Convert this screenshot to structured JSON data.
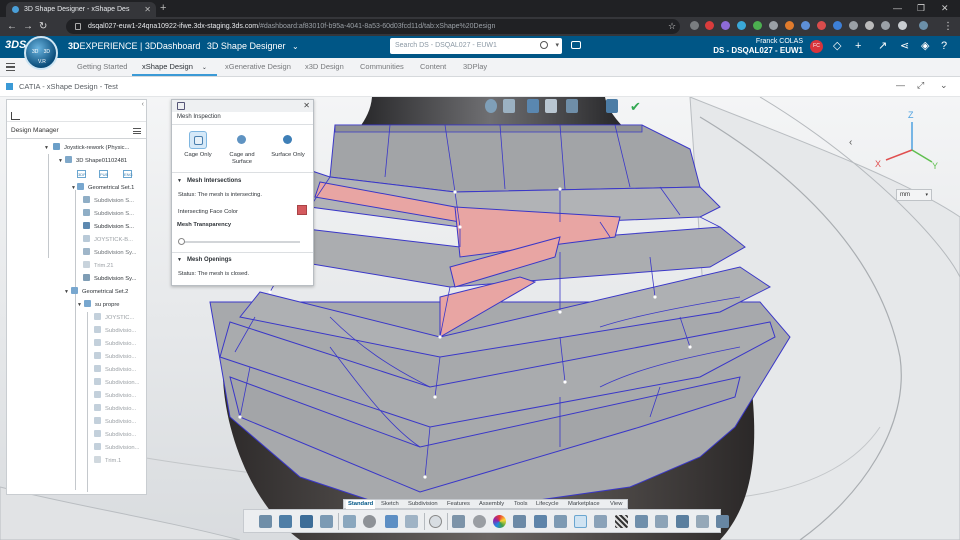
{
  "browser": {
    "tab_title": "3D Shape Designer - xShape Des",
    "url_host": "dsqal027-euw1-24qna10922-ifwe.3dx-staging.3ds.com",
    "url_path": "/#dashboard:af83010f-b95a-4041-8a53-60d03fcd11d/tab:xShape%20Design"
  },
  "header": {
    "brand_bold": "3D",
    "brand_rest": "EXPERIENCE | 3DDashboard",
    "app": "3D Shape Designer",
    "search_placeholder": "Search DS - DSQAL027 - EUW1",
    "user_name": "Franck COLAS",
    "tenant": "DS - DSQAL027 - EUW1",
    "avatar_initials": "FC",
    "compass_labels": [
      "3D",
      "V.R",
      "3D"
    ]
  },
  "dashboard_tabs": [
    {
      "label": "Getting Started"
    },
    {
      "label": "xShape Design"
    },
    {
      "label": "xGenerative Design"
    },
    {
      "label": "x3D Design"
    },
    {
      "label": "Communities"
    },
    {
      "label": "Content"
    },
    {
      "label": "3DPlay"
    }
  ],
  "widget": {
    "title": "CATIA - xShape Design - Test"
  },
  "tree": {
    "title": "Design Manager",
    "icon_labels": [
      "3DP",
      "PUB",
      "ENG"
    ],
    "items": [
      {
        "label": "Joystick-rework (Physic..."
      },
      {
        "label": "3D Shape01102481"
      },
      {
        "label": "Geometrical Set.1"
      },
      {
        "label": "Subdivision S..."
      },
      {
        "label": "Subdivision S..."
      },
      {
        "label": "Subdivision S..."
      },
      {
        "label": "JOYSTICK-B..."
      },
      {
        "label": "Subdivision Sy..."
      },
      {
        "label": "Trim.21"
      },
      {
        "label": "Subdivision Sy..."
      },
      {
        "label": "Geometrical Set.2"
      },
      {
        "label": "su propre"
      },
      {
        "label": "JOYSTIC..."
      },
      {
        "label": "Subdivisio..."
      },
      {
        "label": "Subdivisio..."
      },
      {
        "label": "Subdivisio..."
      },
      {
        "label": "Subdivisio..."
      },
      {
        "label": "Subdivision..."
      },
      {
        "label": "Subdivisio..."
      },
      {
        "label": "Subdivisio..."
      },
      {
        "label": "Subdivisio..."
      },
      {
        "label": "Subdivisio..."
      },
      {
        "label": "Subdivision..."
      },
      {
        "label": "Trim.1"
      }
    ]
  },
  "mesh_panel": {
    "title": "Mesh Inspection",
    "options": [
      "Cage Only",
      "Cage and\nSurface",
      "Surface Only"
    ],
    "intersections_header": "Mesh Intersections",
    "intersections_status": "Status: The mesh is intersecting.",
    "face_color_label": "Intersecting Face Color",
    "face_color": "#d45a5e",
    "transparency_label": "Mesh Transparency",
    "transparency_value": 0,
    "openings_header": "Mesh Openings",
    "openings_status": "Status: The mesh is closed."
  },
  "compass": {
    "x": "X",
    "y": "Y",
    "z": "Z"
  },
  "units": {
    "value": "mm"
  },
  "action_bar_tabs": [
    {
      "label": "Standard"
    },
    {
      "label": "Sketch"
    },
    {
      "label": "Subdivision"
    },
    {
      "label": "Features"
    },
    {
      "label": "Assembly"
    },
    {
      "label": "Tools"
    },
    {
      "label": "Lifecycle"
    },
    {
      "label": "Marketplace"
    },
    {
      "label": "View"
    }
  ],
  "colors": {
    "brand_blue": "#005686",
    "accent": "#3b9ad6",
    "mesh_gray": "#a9abae",
    "mesh_edge": "#3a37c8",
    "intersect": "#e8a5a3"
  }
}
